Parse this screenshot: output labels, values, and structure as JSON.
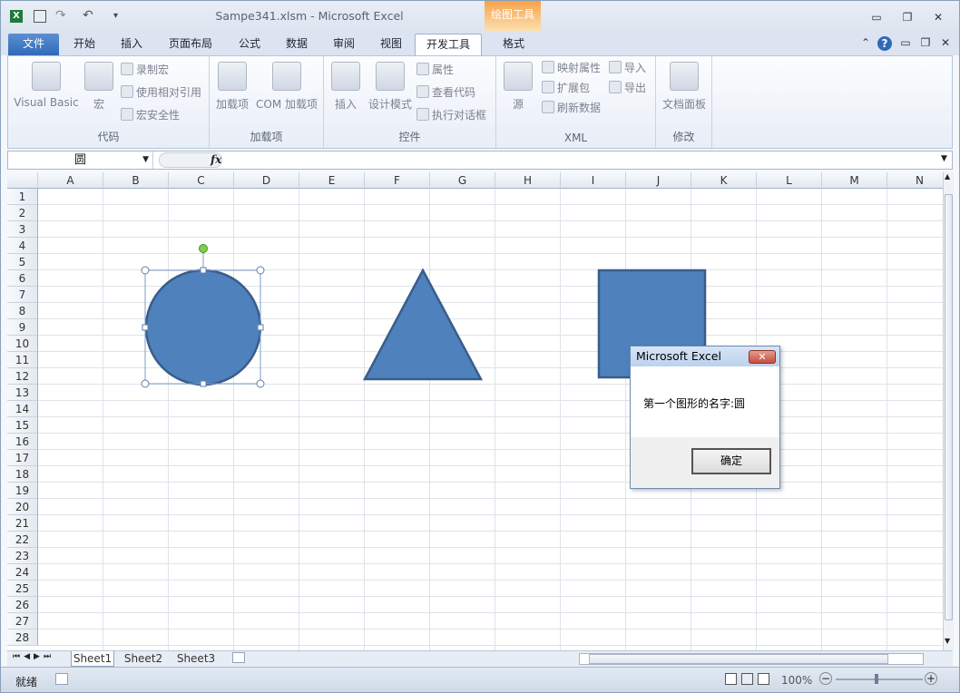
{
  "window": {
    "title": "Sampe341.xlsm  -  Microsoft Excel",
    "context_tab_group": "绘图工具"
  },
  "tabs": [
    "文件",
    "开始",
    "插入",
    "页面布局",
    "公式",
    "数据",
    "审阅",
    "视图",
    "开发工具",
    "格式"
  ],
  "ribbon": {
    "groups": {
      "code": "代码",
      "addins": "加载项",
      "controls": "控件",
      "xml": "XML",
      "modify": "修改"
    },
    "code": {
      "vb": "Visual Basic",
      "macros": "宏",
      "record": "录制宏",
      "relative": "使用相对引用",
      "security": "宏安全性"
    },
    "addins": {
      "addins": "加载项",
      "com": "COM 加载项"
    },
    "controls": {
      "insert": "插入",
      "design": "设计模式",
      "props": "属性",
      "viewcode": "查看代码",
      "dialog": "执行对话框"
    },
    "xml": {
      "source": "源",
      "map": "映射属性",
      "expand": "扩展包",
      "refresh": "刷新数据",
      "import": "导入",
      "export": "导出"
    },
    "modify": {
      "docpanel": "文档面板"
    }
  },
  "formula_bar": {
    "name_box": "圆",
    "fx": "fx",
    "content": ""
  },
  "columns": [
    "A",
    "B",
    "C",
    "D",
    "E",
    "F",
    "G",
    "H",
    "I",
    "J",
    "K",
    "L",
    "M",
    "N"
  ],
  "rows": [
    "1",
    "2",
    "3",
    "4",
    "5",
    "6",
    "7",
    "8",
    "9",
    "10",
    "11",
    "12",
    "13",
    "14",
    "15",
    "16",
    "17",
    "18",
    "19",
    "20",
    "21",
    "22",
    "23",
    "24",
    "25",
    "26",
    "27",
    "28"
  ],
  "sheets": [
    "Sheet1",
    "Sheet2",
    "Sheet3"
  ],
  "status": {
    "ready": "就绪",
    "zoom": "100%"
  },
  "dialog": {
    "title": "Microsoft Excel",
    "message": "第一个图形的名字:圆",
    "ok": "确定",
    "close": "✕"
  },
  "colors": {
    "shape_fill": "#4f81bd",
    "shape_stroke": "#385d8a",
    "accent": "#2f6ab8"
  }
}
